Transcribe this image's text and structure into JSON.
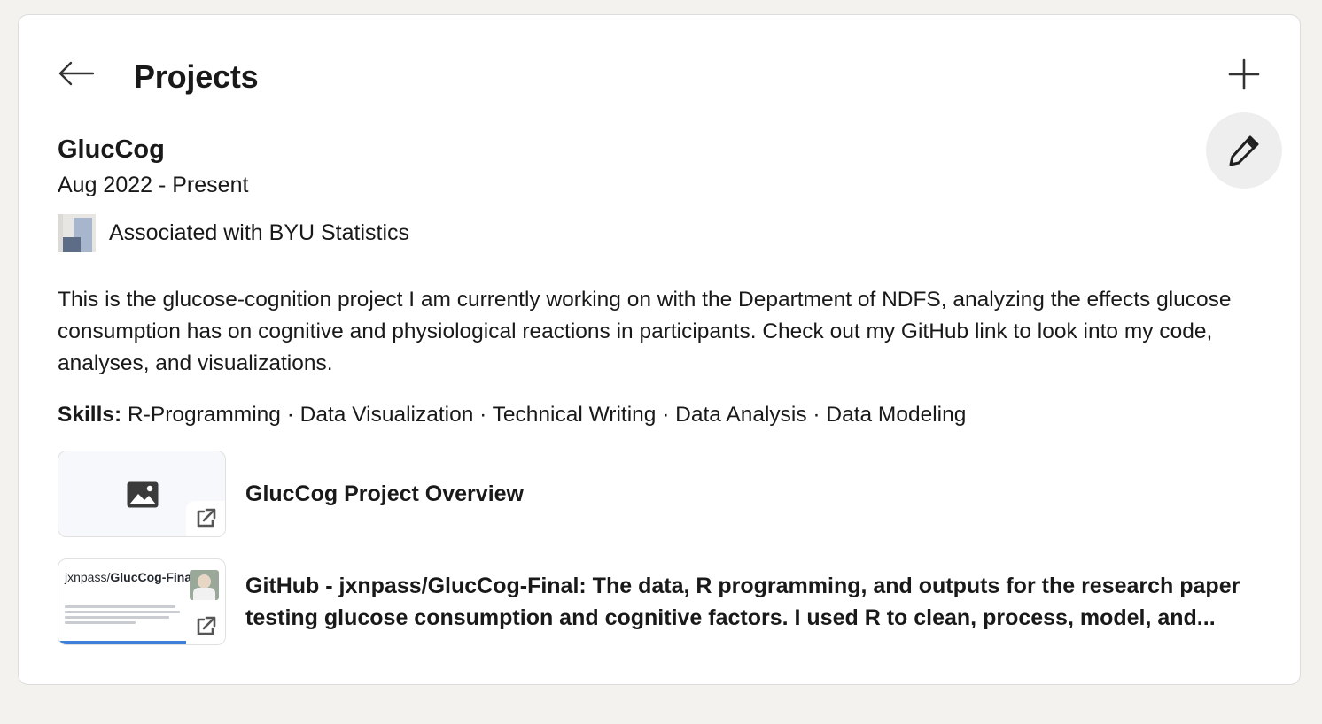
{
  "header": {
    "title": "Projects",
    "back_icon": "arrow-left-icon",
    "add_icon": "plus-icon"
  },
  "project": {
    "name": "GlucCog",
    "dates": "Aug 2022 - Present",
    "association": "Associated with BYU Statistics",
    "description": "This is the glucose-cognition project I am currently working on with the Department of NDFS, analyzing the effects glucose consumption has on cognitive and physiological reactions in participants. Check out my GitHub link to look into my code, analyses, and visualizations.",
    "skills_label": "Skills:",
    "skills": "R-Programming · Data Visualization · Technical Writing · Data Analysis · Data Modeling",
    "edit_icon": "pencil-icon"
  },
  "media": [
    {
      "title": "GlucCog Project Overview",
      "thumbnail_icon": "image-icon",
      "badge_icon": "external-link-icon"
    },
    {
      "title": "GitHub - jxnpass/GlucCog-Final: The data, R programming, and outputs for the research paper testing glucose consumption and cognitive factors. I used R to clean, process, model, and...",
      "thumb_owner": "jxnpass/",
      "thumb_repo": "GlucCog-Final",
      "badge_icon": "external-link-icon"
    }
  ],
  "colors": {
    "page_bg": "#f4f2ee",
    "card_bg": "#ffffff",
    "text": "#191919",
    "edit_button_bg": "#eeeeee"
  }
}
